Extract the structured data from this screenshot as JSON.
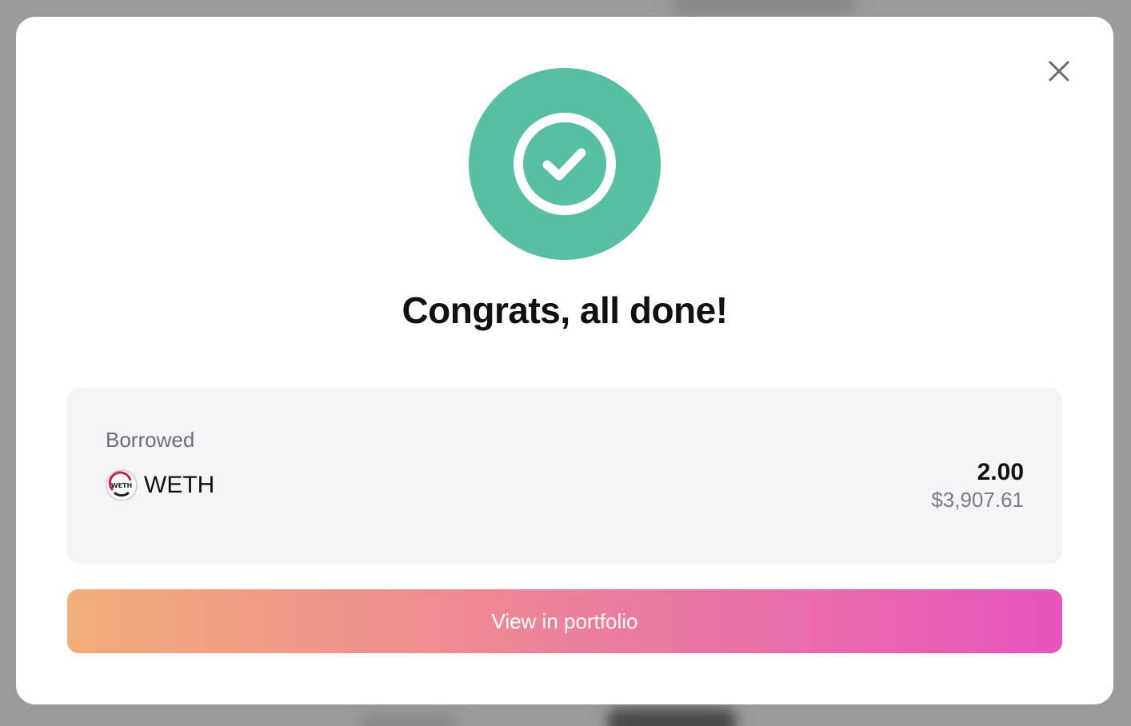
{
  "modal": {
    "title": "Congrats, all done!",
    "close_icon": "close-icon",
    "status_icon": "check-circle-icon"
  },
  "summary": {
    "label": "Borrowed",
    "asset": {
      "symbol": "WETH",
      "logo_text": "WETH",
      "icon": "weth-token-logo"
    },
    "amount": "2.00",
    "amount_usd": "$3,907.61"
  },
  "cta": {
    "label": "View in portfolio"
  },
  "colors": {
    "success": "#57bfa4",
    "cta_gradient_start": "#f2ad78",
    "cta_gradient_end": "#e655bd",
    "backdrop": "#9b9b9d",
    "card_bg": "#f4f4f9"
  }
}
